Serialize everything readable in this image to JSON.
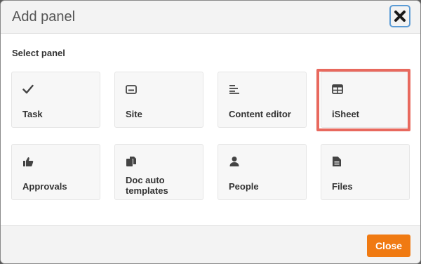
{
  "dialog": {
    "title": "Add panel",
    "close_icon": "close-x-icon",
    "section_label": "Select panel"
  },
  "panels": [
    {
      "label": "Task",
      "icon": "checkmark-icon"
    },
    {
      "label": "Site",
      "icon": "site-card-icon"
    },
    {
      "label": "Content editor",
      "icon": "text-lines-icon"
    },
    {
      "label": "iSheet",
      "icon": "table-icon",
      "highlighted": true
    },
    {
      "label": "Approvals",
      "icon": "thumbs-up-icon"
    },
    {
      "label": "Doc auto templates",
      "icon": "documents-icon"
    },
    {
      "label": "People",
      "icon": "person-icon"
    },
    {
      "label": "Files",
      "icon": "file-icon"
    }
  ],
  "footer": {
    "close_label": "Close"
  },
  "colors": {
    "accent": "#f07a12",
    "highlight": "#e8695e",
    "focus_border": "#5b9bd5"
  }
}
